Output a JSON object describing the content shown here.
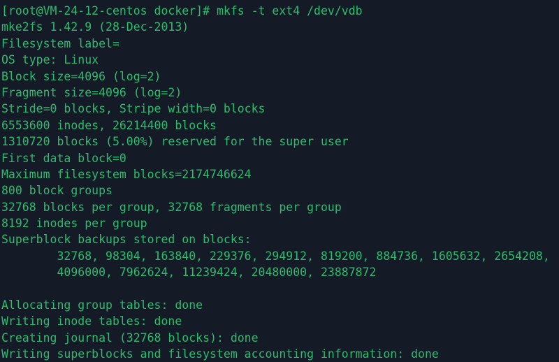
{
  "terminal": {
    "window_title": "",
    "background_color": "#151b26",
    "foreground_color": "#2bbd6e",
    "prompt": "[root@VM-24-12-centos docker]#",
    "command": "mkfs -t ext4 /dev/vdb",
    "user": "root",
    "hostname": "VM-24-12-centos",
    "cwd": "docker",
    "lines": [
      "[root@VM-24-12-centos docker]# mkfs -t ext4 /dev/vdb",
      "mke2fs 1.42.9 (28-Dec-2013)",
      "Filesystem label=",
      "OS type: Linux",
      "Block size=4096 (log=2)",
      "Fragment size=4096 (log=2)",
      "Stride=0 blocks, Stripe width=0 blocks",
      "6553600 inodes, 26214400 blocks",
      "1310720 blocks (5.00%) reserved for the super user",
      "First data block=0",
      "Maximum filesystem blocks=2174746624",
      "800 block groups",
      "32768 blocks per group, 32768 fragments per group",
      "8192 inodes per group",
      "Superblock backups stored on blocks:",
      "        32768, 98304, 163840, 229376, 294912, 819200, 884736, 1605632, 2654208,",
      "        4096000, 7962624, 11239424, 20480000, 23887872",
      "",
      "Allocating group tables: done",
      "Writing inode tables: done",
      "Creating journal (32768 blocks): done",
      "Writing superblocks and filesystem accounting information: done"
    ],
    "mkfs_output": {
      "version": "mke2fs 1.42.9 (28-Dec-2013)",
      "filesystem_label": "",
      "os_type": "Linux",
      "block_size": "4096 (log=2)",
      "fragment_size": "4096 (log=2)",
      "stride": "0 blocks",
      "stripe_width": "0 blocks",
      "inodes": "6553600",
      "blocks": "26214400",
      "reserved_blocks": "1310720",
      "reserved_percent": "5.00%",
      "first_data_block": "0",
      "maximum_filesystem_blocks": "2174746624",
      "block_groups": "800",
      "blocks_per_group": "32768",
      "fragments_per_group": "32768",
      "inodes_per_group": "8192",
      "superblock_backups": [
        "32768",
        "98304",
        "163840",
        "229376",
        "294912",
        "819200",
        "884736",
        "1605632",
        "2654208",
        "4096000",
        "7962624",
        "11239424",
        "20480000",
        "23887872"
      ],
      "steps": [
        "Allocating group tables: done",
        "Writing inode tables: done",
        "Creating journal (32768 blocks): done",
        "Writing superblocks and filesystem accounting information: done"
      ]
    }
  }
}
